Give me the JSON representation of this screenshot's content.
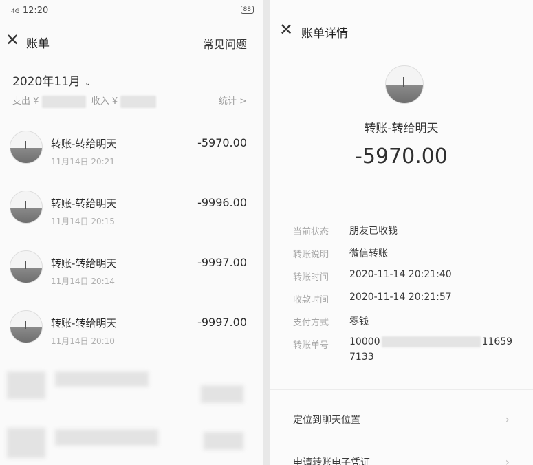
{
  "status_bar": {
    "signal": "4G",
    "time": "12:20",
    "right_icons": "⁴ᴳ",
    "battery": "88"
  },
  "left": {
    "title": "账单",
    "help": "常见问题",
    "month": "2020年11月",
    "summary": {
      "expense_label": "支出 ¥",
      "income_label": "收入 ¥"
    },
    "stats": "统计 >",
    "transactions": [
      {
        "name": "转账-转给明天",
        "time": "11月14日 20:21",
        "amount": "-5970.00"
      },
      {
        "name": "转账-转给明天",
        "time": "11月14日 20:15",
        "amount": "-9996.00"
      },
      {
        "name": "转账-转给明天",
        "time": "11月14日 20:14",
        "amount": "-9997.00"
      },
      {
        "name": "转账-转给明天",
        "time": "11月14日 20:10",
        "amount": "-9997.00"
      }
    ]
  },
  "right": {
    "title": "账单详情",
    "payee": "转账-转给明天",
    "amount": "-5970.00",
    "details": [
      {
        "label": "当前状态",
        "value": "朋友已收钱"
      },
      {
        "label": "转账说明",
        "value": "微信转账"
      },
      {
        "label": "转账时间",
        "value": "2020-11-14 20:21:40"
      },
      {
        "label": "收款时间",
        "value": "2020-11-14 20:21:57"
      },
      {
        "label": "支付方式",
        "value": "零钱"
      }
    ],
    "txid_label": "转账单号",
    "txid_prefix": "10000",
    "txid_suffix": "11659",
    "txid_line2": "7133",
    "links": [
      {
        "label": "定位到聊天位置"
      },
      {
        "label": "申请转账电子凭证"
      }
    ]
  }
}
